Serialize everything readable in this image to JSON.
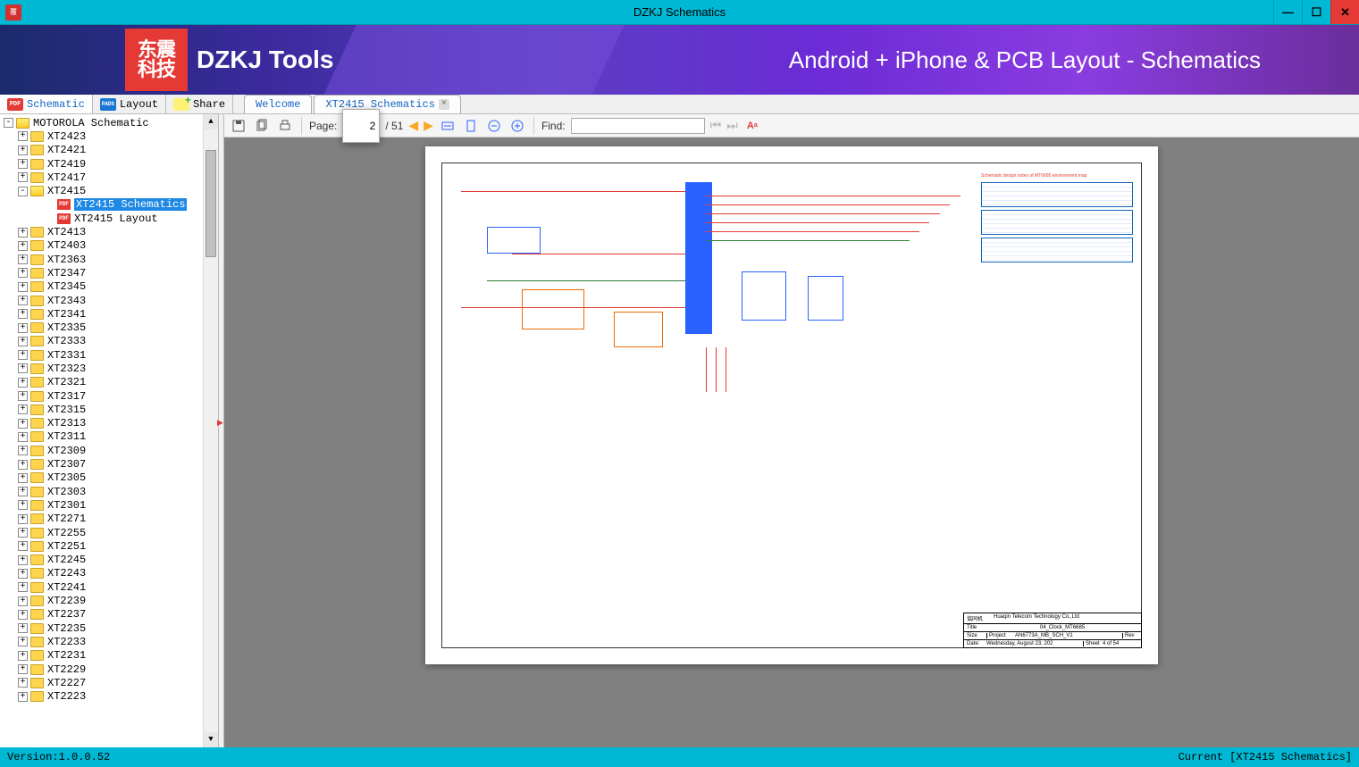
{
  "window": {
    "title": "DZKJ Schematics"
  },
  "banner": {
    "logo_cn": "东震\n科技",
    "logo_text": "DZKJ Tools",
    "tagline": "Android + iPhone & PCB Layout - Schematics"
  },
  "sidebar_tabs": [
    {
      "label": "Schematic",
      "icon": "pdf",
      "active": true
    },
    {
      "label": "Layout",
      "icon": "pads"
    },
    {
      "label": "Share",
      "icon": "share"
    }
  ],
  "doc_tabs": [
    {
      "label": "Welcome",
      "closable": false
    },
    {
      "label": "XT2415 Schematics",
      "closable": true
    }
  ],
  "tree": {
    "root": "MOTOROLA Schematic",
    "expanded": "XT2415",
    "children_of_expanded": [
      {
        "label": "XT2415 Schematics",
        "selected": true
      },
      {
        "label": "XT2415 Layout"
      }
    ],
    "items": [
      "XT2423",
      "XT2421",
      "XT2419",
      "XT2417",
      "XT2415",
      "XT2413",
      "XT2403",
      "XT2363",
      "XT2347",
      "XT2345",
      "XT2343",
      "XT2341",
      "XT2335",
      "XT2333",
      "XT2331",
      "XT2323",
      "XT2321",
      "XT2317",
      "XT2315",
      "XT2313",
      "XT2311",
      "XT2309",
      "XT2307",
      "XT2305",
      "XT2303",
      "XT2301",
      "XT2271",
      "XT2255",
      "XT2251",
      "XT2245",
      "XT2243",
      "XT2241",
      "XT2239",
      "XT2237",
      "XT2235",
      "XT2233",
      "XT2231",
      "XT2229",
      "XT2227",
      "XT2223"
    ]
  },
  "toolbar": {
    "page_label": "Page:",
    "page_current": "2",
    "page_total": "/ 51",
    "find_label": "Find:",
    "find_value": ""
  },
  "titleblock": {
    "company": "Huaqin Telecom Technology Co.,Ltd",
    "title_lbl": "Title",
    "title": "04_Clock_MT6685",
    "size_lbl": "Size",
    "project_lbl": "Project",
    "project": "AN6773A_MB_SCH_V1",
    "rev_lbl": "Rev",
    "date_lbl": "Date:",
    "date": "Wednesday, August 23, 202",
    "sheet_lbl": "Sheet",
    "sheet": "4   of   54"
  },
  "status": {
    "version": "Version:1.0.0.52",
    "current": "Current [XT2415 Schematics]"
  }
}
